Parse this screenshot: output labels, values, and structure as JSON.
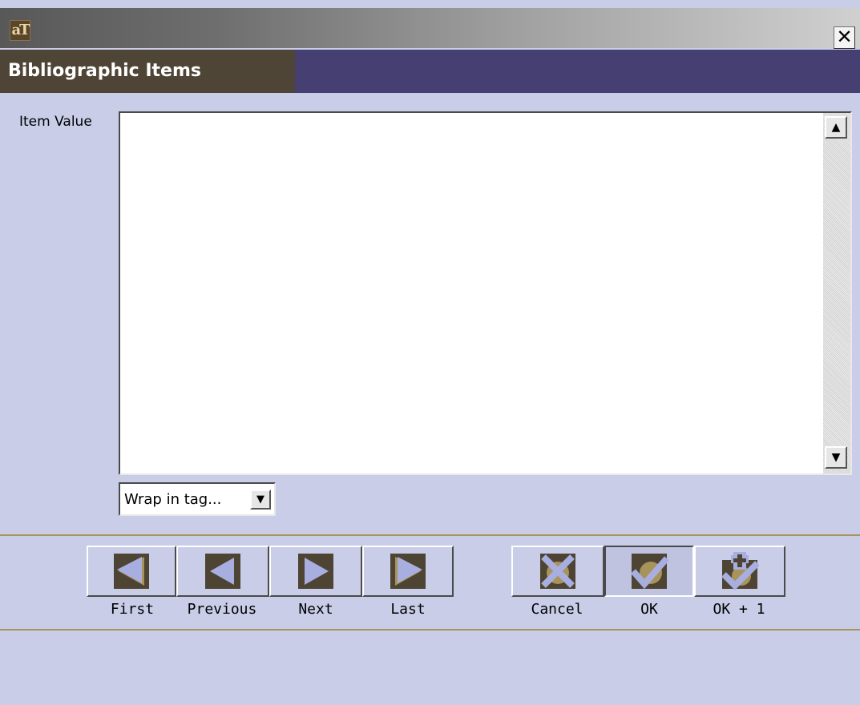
{
  "window": {
    "app_icon_text": "aT",
    "close_glyph": "✕",
    "icons": {
      "app": "app-icon",
      "close": "close-icon"
    }
  },
  "header": {
    "title": "Bibliographic Items"
  },
  "form": {
    "item_value_label": "Item Value",
    "item_value": "",
    "wrap_dropdown_value": "Wrap in tag...",
    "scroll_up_glyph": "▲",
    "scroll_down_glyph": "▼",
    "dropdown_glyph": "▼"
  },
  "buttons": {
    "first": "First",
    "previous": "Previous",
    "next": "Next",
    "last": "Last",
    "cancel": "Cancel",
    "ok": "OK",
    "ok_plus_one": "OK + 1"
  },
  "colors": {
    "background": "#c9cde8",
    "header_left": "#4f4536",
    "header_right": "#463f72",
    "icon_dark": "#4d4433",
    "icon_light": "#a9aee0",
    "icon_accent": "#a8945a",
    "divider": "#a8945a"
  }
}
